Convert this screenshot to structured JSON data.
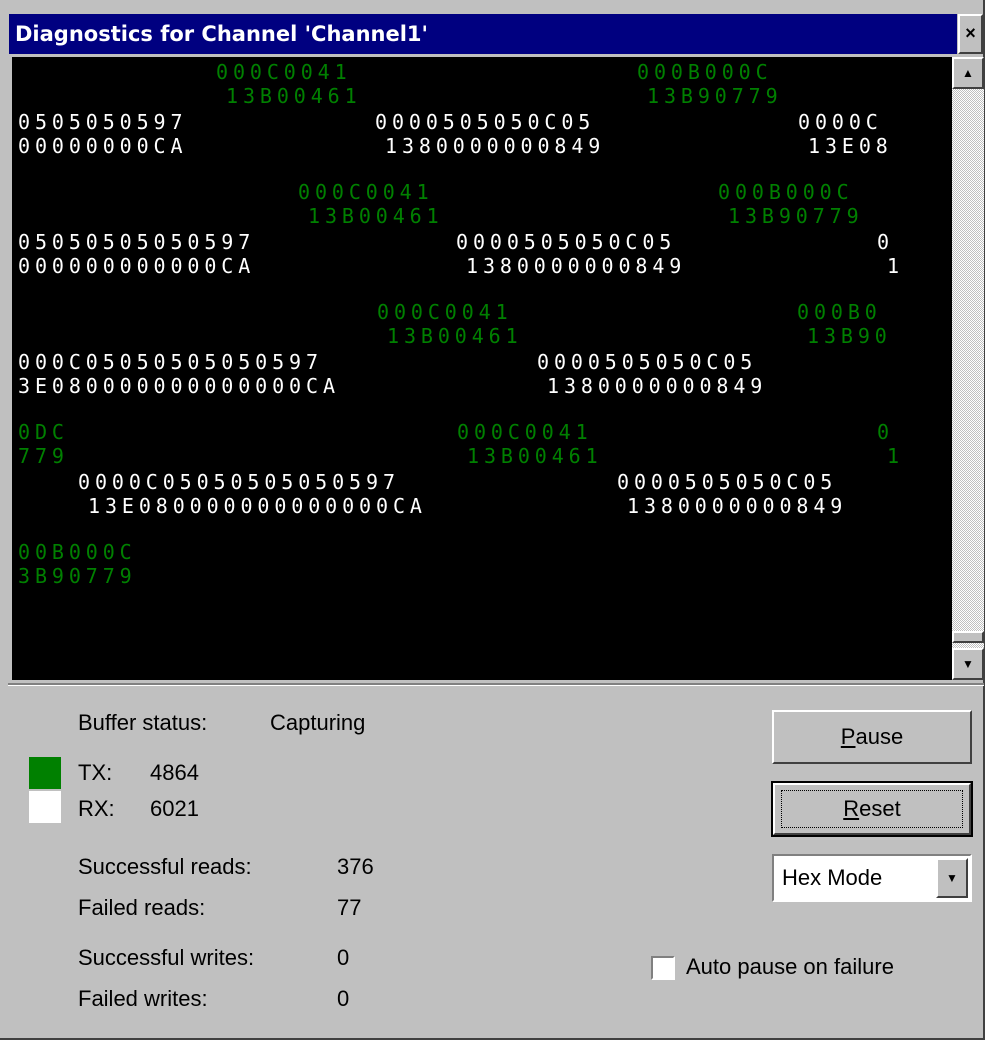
{
  "window": {
    "title": "Diagnostics for Channel 'Channel1'",
    "close_glyph": "×"
  },
  "console": {
    "lines": [
      {
        "text": "000C0041",
        "kind": "tx"
      },
      {
        "text": "000B000C",
        "kind": "tx"
      },
      {
        "text": "13B00461",
        "kind": "tx"
      },
      {
        "text": "13B90779",
        "kind": "tx"
      },
      {
        "text": "0505050597",
        "kind": "rx"
      },
      {
        "text": "0000505050C05",
        "kind": "rx"
      },
      {
        "text": "0000C",
        "kind": "rx"
      },
      {
        "text": "00000000CA",
        "kind": "rx"
      },
      {
        "text": "1380000000849",
        "kind": "rx"
      },
      {
        "text": "13E08",
        "kind": "rx"
      },
      {
        "text": "000C0041",
        "kind": "tx"
      },
      {
        "text": "000B000C",
        "kind": "tx"
      },
      {
        "text": "13B00461",
        "kind": "tx"
      },
      {
        "text": "13B90779",
        "kind": "tx"
      },
      {
        "text": "05050505050597",
        "kind": "rx"
      },
      {
        "text": "0000505050C05",
        "kind": "rx"
      },
      {
        "text": "0",
        "kind": "rx"
      },
      {
        "text": "000000000000CA",
        "kind": "rx"
      },
      {
        "text": "1380000000849",
        "kind": "rx"
      },
      {
        "text": "1",
        "kind": "rx"
      },
      {
        "text": "000C0041",
        "kind": "tx"
      },
      {
        "text": "000B0",
        "kind": "tx"
      },
      {
        "text": "13B00461",
        "kind": "tx"
      },
      {
        "text": "13B90",
        "kind": "tx"
      },
      {
        "text": "000C05050505050597",
        "kind": "rx"
      },
      {
        "text": "0000505050C05",
        "kind": "rx"
      },
      {
        "text": "3E080000000000000CA",
        "kind": "rx"
      },
      {
        "text": "1380000000849",
        "kind": "rx"
      },
      {
        "text": "0DC",
        "kind": "tx"
      },
      {
        "text": "000C0041",
        "kind": "tx"
      },
      {
        "text": "0",
        "kind": "tx"
      },
      {
        "text": "779",
        "kind": "tx"
      },
      {
        "text": "13B00461",
        "kind": "tx"
      },
      {
        "text": "1",
        "kind": "tx"
      },
      {
        "text": "0000C05050505050597",
        "kind": "rx"
      },
      {
        "text": "0000505050C05",
        "kind": "rx"
      },
      {
        "text": "13E080000000000000CA",
        "kind": "rx"
      },
      {
        "text": "1380000000849",
        "kind": "rx"
      },
      {
        "text": "00B000C",
        "kind": "tx"
      },
      {
        "text": "3B90779",
        "kind": "tx"
      }
    ]
  },
  "scrollbar": {
    "up_glyph": "▲",
    "down_glyph": "▼"
  },
  "status": {
    "buffer_label": "Buffer status:",
    "buffer_value": "Capturing",
    "tx_label": "TX:",
    "tx_value": "4864",
    "tx_color": "#008000",
    "rx_label": "RX:",
    "rx_value": "6021",
    "rx_color": "#ffffff",
    "successful_reads_label": "Successful reads:",
    "successful_reads_value": "376",
    "failed_reads_label": "Failed reads:",
    "failed_reads_value": "77",
    "successful_writes_label": "Successful writes:",
    "successful_writes_value": "0",
    "failed_writes_label": "Failed writes:",
    "failed_writes_value": "0"
  },
  "controls": {
    "pause_accel": "P",
    "pause_rest": "ause",
    "reset_accel": "R",
    "reset_rest": "eset",
    "mode_selected": "Hex Mode",
    "mode_arrow": "▼",
    "auto_pause_label": "Auto pause on failure",
    "auto_pause_checked": false
  }
}
